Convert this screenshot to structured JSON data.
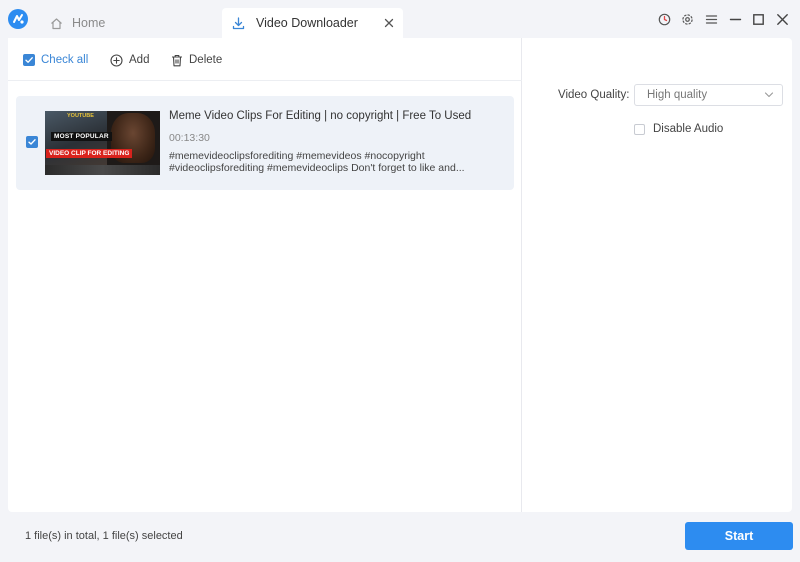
{
  "tabs": {
    "home_label": "Home",
    "active_label": "Video Downloader"
  },
  "toolbar": {
    "check_all_label": "Check all",
    "add_label": "Add",
    "delete_label": "Delete"
  },
  "video": {
    "title": "Meme Video Clips For Editing | no copyright | Free To Used",
    "duration": "00:13:30",
    "description_line1": "#memevideoclipsforediting #memevideos #nocopyright",
    "description_line2": "#videoclipsforediting #memevideoclips Don't forget to like and...",
    "checked": true,
    "thumbnail_text": {
      "top": "YOUTUBE",
      "middle": "MOST POPULAR",
      "bottom": "VIDEO CLIP FOR EDITING"
    }
  },
  "settings": {
    "quality_label": "Video Quality:",
    "quality_value": "High quality",
    "disable_audio_label": "Disable Audio",
    "disable_audio_checked": false
  },
  "footer": {
    "status": "1 file(s) in total, 1 file(s) selected",
    "start_label": "Start"
  },
  "colors": {
    "accent": "#2d8cf0",
    "check_blue": "#3a86d6",
    "background": "#f3f4f8",
    "row_bg": "#eef2f8"
  },
  "icons": {
    "app": "app-logo-icon",
    "home": "home-icon",
    "download": "download-icon",
    "close": "close-icon",
    "timer": "timer-icon",
    "settings": "gear-icon",
    "menu": "menu-icon",
    "minimize": "minimize-icon",
    "maximize": "maximize-icon",
    "window_close": "window-close-icon",
    "add": "plus-circle-icon",
    "delete": "trash-icon",
    "chevron": "chevron-down-icon"
  }
}
